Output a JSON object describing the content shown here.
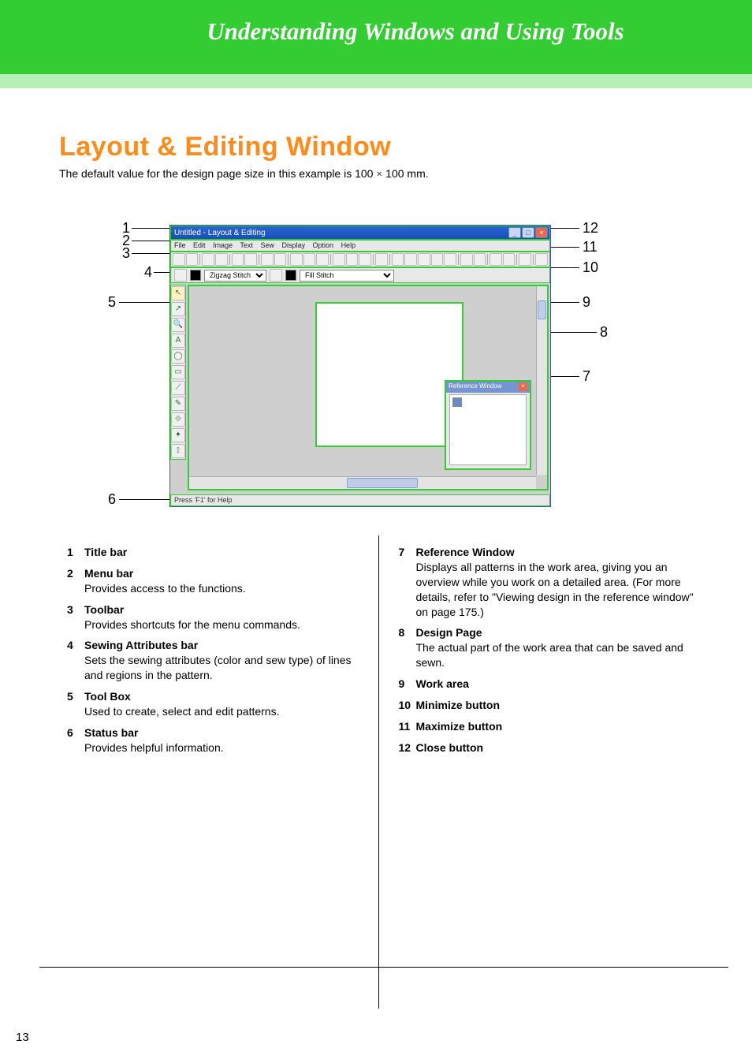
{
  "header": {
    "banner_title": "Understanding Windows and Using Tools"
  },
  "page": {
    "heading": "Layout & Editing Window",
    "intro_pre": "The default value for the design page size in this example is 100 ",
    "intro_post": " 100 mm.",
    "multiply": "×",
    "page_number": "13"
  },
  "app": {
    "title": "Untitled - Layout & Editing",
    "menu": {
      "file": "File",
      "edit": "Edit",
      "image": "Image",
      "text": "Text",
      "sew": "Sew",
      "display": "Display",
      "option": "Option",
      "help": "Help"
    },
    "attr": {
      "line_stitch": "Zigzag Stitch",
      "fill_stitch": "Fill Stitch"
    },
    "ref_title": "Reference Window",
    "status": "Press 'F1' for Help"
  },
  "labels": {
    "l1": "1",
    "l2": "2",
    "l3": "3",
    "l4": "4",
    "l5": "5",
    "l6": "6",
    "l7": "7",
    "l8": "8",
    "l9": "9",
    "l10": "10",
    "l11": "11",
    "l12": "12"
  },
  "left_items": [
    {
      "num": "1",
      "title": "Title bar",
      "desc": ""
    },
    {
      "num": "2",
      "title": "Menu bar",
      "desc": "Provides access to the functions."
    },
    {
      "num": "3",
      "title": "Toolbar",
      "desc": "Provides shortcuts for the menu commands."
    },
    {
      "num": "4",
      "title": "Sewing Attributes bar",
      "desc": "Sets the sewing attributes (color and sew type) of lines and regions in the pattern."
    },
    {
      "num": "5",
      "title": "Tool Box",
      "desc": "Used to create, select and edit patterns."
    },
    {
      "num": "6",
      "title": "Status bar",
      "desc": "Provides helpful information."
    }
  ],
  "right_items": [
    {
      "num": "7",
      "title": "Reference Window",
      "desc": "Displays all patterns in the work area, giving you an overview while you work on a detailed area. (For more details, refer to \"Viewing design in the reference window\" on page 175.)"
    },
    {
      "num": "8",
      "title": "Design Page",
      "desc": "The actual part of the work area that can be saved and sewn."
    },
    {
      "num": "9",
      "title": "Work area",
      "desc": ""
    },
    {
      "num": "10",
      "title": "Minimize button",
      "desc": ""
    },
    {
      "num": "11",
      "title": "Maximize button",
      "desc": ""
    },
    {
      "num": "12",
      "title": "Close button",
      "desc": ""
    }
  ]
}
